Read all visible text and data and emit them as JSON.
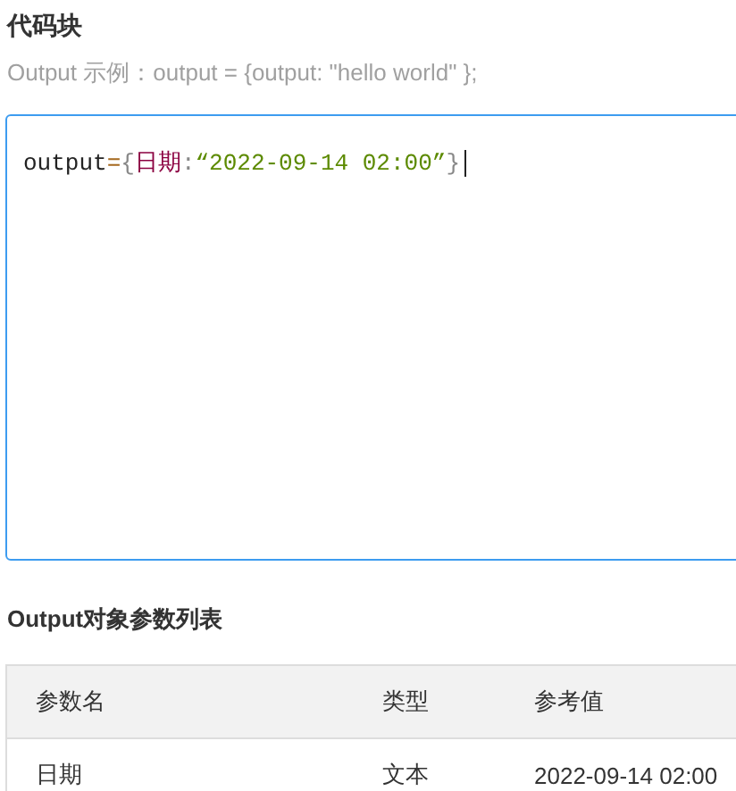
{
  "title": "代码块",
  "hint": "Output 示例：output = {output: \"hello world\" };",
  "code": [
    {
      "kind": "plain",
      "text": "output"
    },
    {
      "kind": "operator",
      "text": "="
    },
    {
      "kind": "punct",
      "text": "{"
    },
    {
      "kind": "key",
      "text": "日期"
    },
    {
      "kind": "punct",
      "text": ":"
    },
    {
      "kind": "string",
      "text": "“2022-09-14 02:00”"
    },
    {
      "kind": "punct",
      "text": "}"
    }
  ],
  "params_title": "Output对象参数列表",
  "table": {
    "columns": [
      "参数名",
      "类型",
      "参考值"
    ],
    "rows": [
      [
        "日期",
        "文本",
        "2022-09-14 02:00"
      ]
    ]
  }
}
